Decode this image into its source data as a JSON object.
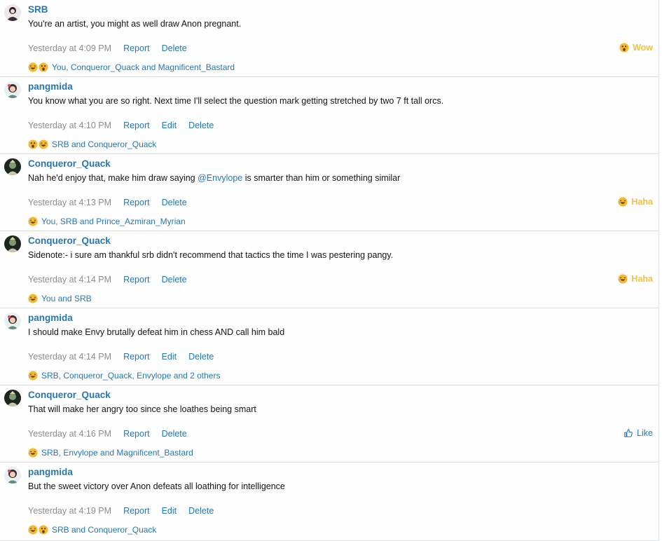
{
  "colors": {
    "link": "#2577b1",
    "timestamp": "#8c8c8c",
    "reaction_gold": "#f2c13e",
    "divider": "#d8dde3"
  },
  "posts": [
    {
      "username": "SRB",
      "avatar": "srb-avatar",
      "message": "You're an artist, you might as well draw Anon pregnant.",
      "timestamp": "Yesterday at 4:09 PM",
      "actions": {
        "report": "Report",
        "delete": "Delete"
      },
      "my_reaction": {
        "icon": "wow-emoji-icon",
        "label": "Wow"
      },
      "reaction_emojis": [
        "haha-emoji-icon",
        "wow-emoji-icon"
      ],
      "reactions_text": "You, Conqueror_Quack and Magnificent_Bastard"
    },
    {
      "username": "pangmida",
      "avatar": "pangmida-avatar",
      "message": "You know what you are so right. Next time I'll select the question mark getting stretched by two 7 ft tall orcs.",
      "timestamp": "Yesterday at 4:10 PM",
      "actions": {
        "report": "Report",
        "edit": "Edit",
        "delete": "Delete"
      },
      "reaction_emojis": [
        "wow-emoji-icon",
        "haha-emoji-icon"
      ],
      "reactions_text": "SRB and Conqueror_Quack"
    },
    {
      "username": "Conqueror_Quack",
      "avatar": "conqueror-avatar",
      "message_before": "Nah he'd enjoy that, make him draw saying ",
      "mention": "@Envylope",
      "message_after": " is smarter than him or something similar",
      "timestamp": "Yesterday at 4:13 PM",
      "actions": {
        "report": "Report",
        "delete": "Delete"
      },
      "my_reaction": {
        "icon": "haha-emoji-icon",
        "label": "Haha"
      },
      "reaction_emojis": [
        "haha-emoji-icon"
      ],
      "reactions_text": "You, SRB and Prince_Azmiran_Myrian"
    },
    {
      "username": "Conqueror_Quack",
      "avatar": "conqueror-avatar",
      "message": "Sidenote:- i sure am thankful srb didn't recommend that tactics the time I was pestering pangy.",
      "timestamp": "Yesterday at 4:14 PM",
      "actions": {
        "report": "Report",
        "delete": "Delete"
      },
      "my_reaction": {
        "icon": "haha-emoji-icon",
        "label": "Haha"
      },
      "reaction_emojis": [
        "haha-emoji-icon"
      ],
      "reactions_text": "You and SRB"
    },
    {
      "username": "pangmida",
      "avatar": "pangmida-avatar",
      "message": "I should make Envy brutally defeat him in chess AND call him bald",
      "timestamp": "Yesterday at 4:14 PM",
      "actions": {
        "report": "Report",
        "edit": "Edit",
        "delete": "Delete"
      },
      "reaction_emojis": [
        "haha-emoji-icon"
      ],
      "reactions_text": "SRB, Conqueror_Quack, Envylope and 2 others"
    },
    {
      "username": "Conqueror_Quack",
      "avatar": "conqueror-avatar",
      "message": "That will make her angry too since she loathes being smart",
      "timestamp": "Yesterday at 4:16 PM",
      "actions": {
        "report": "Report",
        "delete": "Delete"
      },
      "my_reaction": {
        "icon": "thumbs-up-icon",
        "label": "Like"
      },
      "reaction_emojis": [
        "haha-emoji-icon"
      ],
      "reactions_text": "SRB, Envylope and Magnificent_Bastard"
    },
    {
      "username": "pangmida",
      "avatar": "pangmida-avatar",
      "message": "But the sweet victory over Anon defeats all loathing for intelligence",
      "timestamp": "Yesterday at 4:19 PM",
      "actions": {
        "report": "Report",
        "edit": "Edit",
        "delete": "Delete"
      },
      "reaction_emojis": [
        "haha-emoji-icon",
        "wow-emoji-icon"
      ],
      "reactions_text": "SRB and Conqueror_Quack"
    }
  ]
}
